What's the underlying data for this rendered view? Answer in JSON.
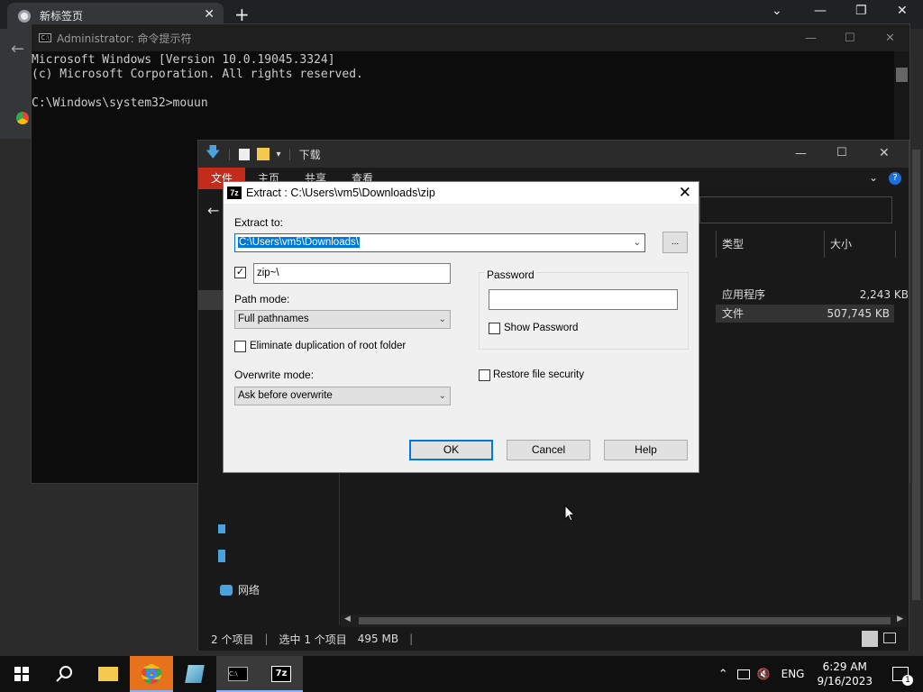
{
  "chrome": {
    "tab_title": "新标签页",
    "controls": [
      "⌄",
      "—",
      "❐",
      "✕"
    ]
  },
  "cmd": {
    "title": "Administrator: 命令提示符",
    "lines": [
      "Microsoft Windows [Version 10.0.19045.3324]",
      "(c) Microsoft Corporation. All rights reserved.",
      "",
      "C:\\Windows\\system32>mouun"
    ]
  },
  "explorer": {
    "title": "下载",
    "ribbon_tabs": [
      "文件",
      "主页",
      "共享",
      "查看"
    ],
    "columns": {
      "type": "类型",
      "size": "大小"
    },
    "rows": [
      {
        "type": "应用程序",
        "size": "2,243 KB",
        "selected": false
      },
      {
        "type": "文件",
        "size": "507,745 KB",
        "selected": true
      }
    ],
    "nav_network": "网络",
    "status": {
      "count": "2 个项目",
      "selection": "选中 1 个项目",
      "size": "495 MB"
    }
  },
  "dialog": {
    "title": "Extract : C:\\Users\\vm5\\Downloads\\zip",
    "extract_to_label": "Extract to:",
    "extract_to_value": "C:\\Users\\vm5\\Downloads\\",
    "browse_label": "...",
    "subfolder_value": "zip~\\",
    "subfolder_checked": true,
    "path_mode_label": "Path mode:",
    "path_mode_value": "Full pathnames",
    "eliminate_label": "Eliminate duplication of root folder",
    "overwrite_label": "Overwrite mode:",
    "overwrite_value": "Ask before overwrite",
    "password_label": "Password",
    "show_password_label": "Show Password",
    "restore_security_label": "Restore file security",
    "ok_label": "OK",
    "cancel_label": "Cancel",
    "help_label": "Help"
  },
  "taskbar": {
    "lang": "ENG",
    "time": "6:29 AM",
    "date": "9/16/2023",
    "notification_count": "1"
  }
}
